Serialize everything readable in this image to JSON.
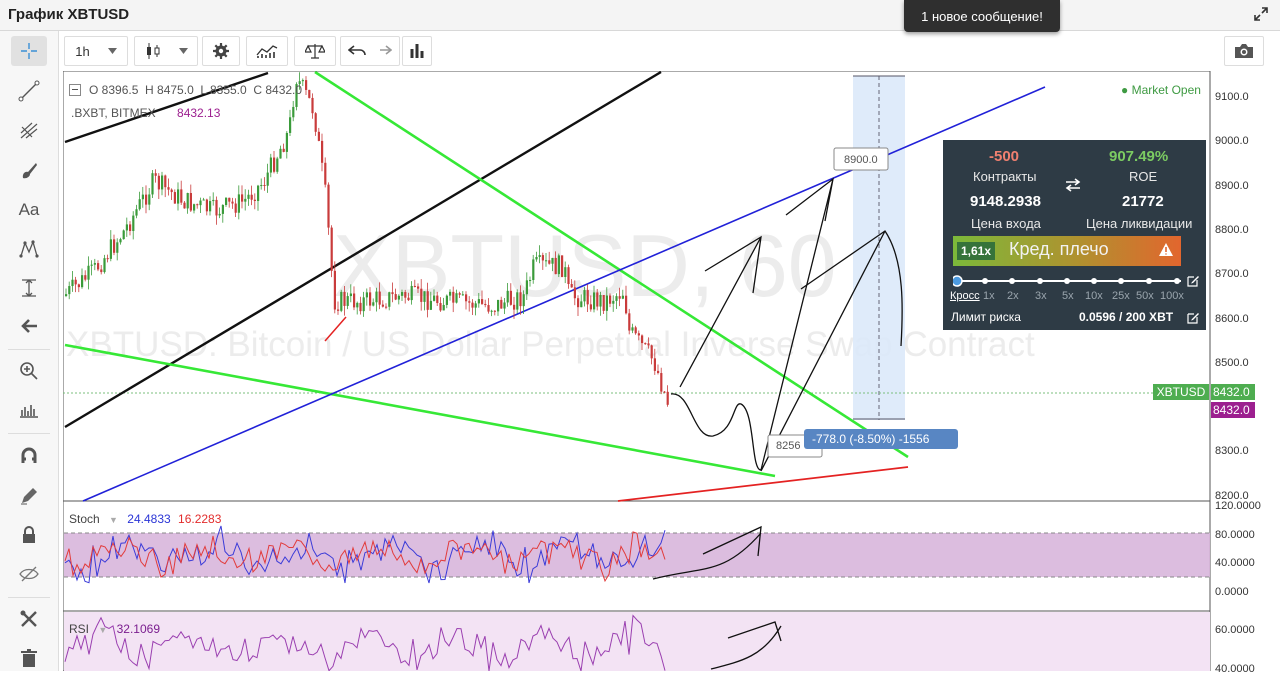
{
  "window": {
    "title": "График XBTUSD",
    "notification": "1 новое сообщение!"
  },
  "toolbar": {
    "interval": "1h"
  },
  "chart": {
    "ohlc": "O 8396.5  H 8475.0  L 8355.0  C 8432.0",
    "index_label": ".BXBT, BITMEX",
    "index_value": "8432.13",
    "market_status": "Market Open",
    "watermark_symbol": "XBTUSD, 60",
    "watermark_desc": "XBTUSD: Bitcoin / US Dollar Perpetual Inverse Swap Contract",
    "price_axis": [
      "9100.0",
      "9000.0",
      "8900.0",
      "8800.0",
      "8700.0",
      "8600.0",
      "8500.0",
      "8400.0",
      "8300.0",
      "8200.0"
    ],
    "last_price_tag": "XBTUSD",
    "last_price": "8432.0",
    "mark_price": "8432.0",
    "range_top": "8900.0",
    "range_bottom": "8256",
    "range_change": "-778.0 (-8.50%) -1556",
    "accent_green": "#4ead50",
    "accent_purple": "#9c1f8f"
  },
  "stoch": {
    "label": "Stoch",
    "k": "24.4833",
    "d": "16.2283",
    "axis": [
      "120.0000",
      "80.0000",
      "40.0000",
      "0.0000"
    ]
  },
  "rsi": {
    "label": "RSI",
    "value": "32.1069",
    "axis": [
      "60.0000",
      "40.0000"
    ]
  },
  "position": {
    "contracts": "-500",
    "contracts_label": "Контракты",
    "roe": "907.49%",
    "roe_label": "ROE",
    "entry": "9148.2938",
    "entry_label": "Цена входа",
    "liq": "21772",
    "liq_label": "Цена ликвидации",
    "leverage_value": "1,61x",
    "leverage_label": "Кред. плечо",
    "cross_label": "Кросс",
    "lev_steps": [
      "1x",
      "2x",
      "3x",
      "5x",
      "10x",
      "25x",
      "50x",
      "100x"
    ],
    "risk_label": "Лимит риска",
    "risk_value": "0.0596 / 200 XBT"
  }
}
